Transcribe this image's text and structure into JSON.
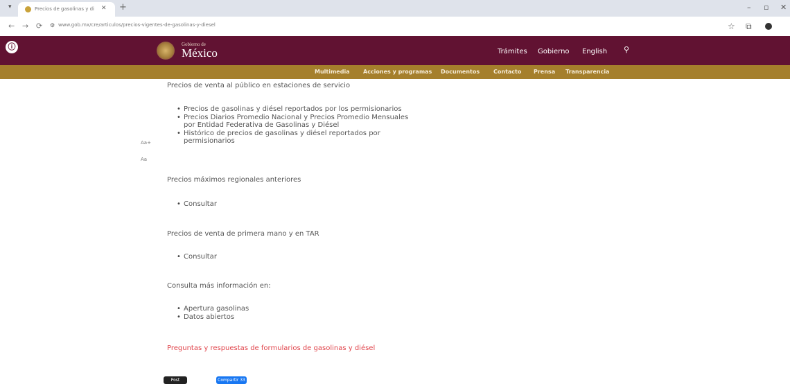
{
  "browser": {
    "tab_title": "Precios de gasolinas y diésel",
    "url": "www.gob.mx/cre/articulos/precios-vigentes-de-gasolinas-y-diesel",
    "icons": {
      "tab_menu": "▾",
      "new_tab": "+",
      "close_tab": "✕",
      "back": "←",
      "forward": "→",
      "reload": "⟳",
      "lock": "⚙",
      "star": "☆",
      "extensions": "⧉",
      "minimize": "–",
      "maximize": "▫",
      "close": "✕"
    }
  },
  "header": {
    "logo_small": "Gobierno de",
    "logo_big": "México",
    "nav": [
      "Trámites",
      "Gobierno",
      "English"
    ],
    "accessibility_glyph": "ⓘ",
    "search_glyph": "⚲",
    "colors": {
      "primary": "#611232",
      "secondary": "#a57f2c"
    }
  },
  "subnav": [
    "Multimedia",
    "Acciones y programas",
    "Documentos",
    "Contacto",
    "Prensa",
    "Transparencia"
  ],
  "font_controls": [
    "Aa+",
    "Aa"
  ],
  "content": {
    "section1_title": "Precios de venta al público en estaciones de servicio",
    "section1_items": [
      "Precios de gasolinas y diésel reportados por los permisionarios",
      [
        "Precios Diarios Promedio Nacional y Precios Promedio Mensuales",
        "por Entidad Federativa de Gasolinas y Diésel"
      ],
      [
        "Histórico de precios de gasolinas y diésel reportados por",
        "permisionarios"
      ]
    ],
    "section2_title": "Precios máximos regionales anteriores",
    "section2_items": [
      "Consultar"
    ],
    "section3_title": "Precios de venta de primera mano y en TAR",
    "section3_items": [
      "Consultar"
    ],
    "section4_title": "Consulta más información en:",
    "section4_items": [
      "Apertura gasolinas",
      "Datos abiertos"
    ],
    "faq_link": "Preguntas y respuestas de formularios de gasolinas y diésel",
    "link_color": "#e0444b"
  },
  "share": {
    "post": "Post",
    "facebook": "Compartir 33"
  }
}
